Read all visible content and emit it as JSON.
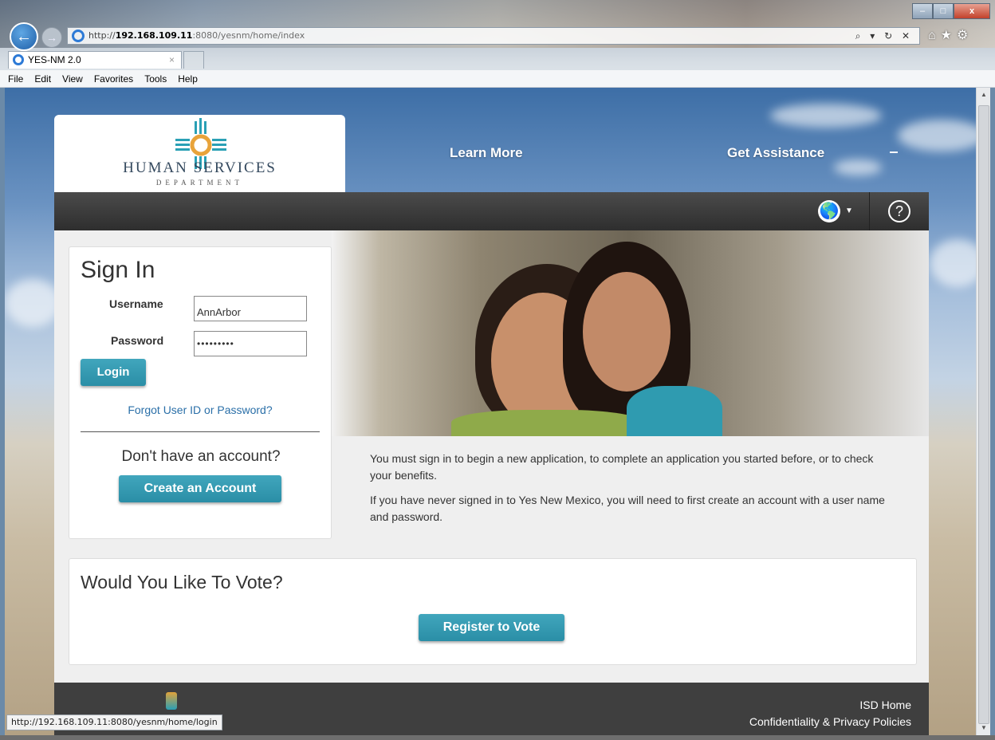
{
  "browser": {
    "address": {
      "scheme": "http://",
      "host": "192.168.109.11",
      "path": ":8080/yesnm/home/index"
    },
    "address_icons": "⌕ ▾ ↻ ✕",
    "toolbar_icons": "⌂★⚙",
    "tab_title": "YES-NM 2.0",
    "tab_close": "×",
    "window_buttons": {
      "minimize": "–",
      "maximize": "□",
      "close": "x"
    },
    "menu": [
      "File",
      "Edit",
      "View",
      "Favorites",
      "Tools",
      "Help"
    ],
    "status_url": "http://192.168.109.11:8080/yesnm/home/login",
    "back_icon": "←",
    "forward_icon": "→"
  },
  "site": {
    "logo": {
      "title": "HUMAN SERVICES",
      "subtitle": "DEPARTMENT"
    },
    "nav": {
      "learn_more": "Learn More",
      "get_assistance": "Get Assistance"
    },
    "globe_icon": "language-globe-icon",
    "help_label": "?"
  },
  "signin": {
    "title": "Sign In",
    "username_label": "Username",
    "username_value": "AnnArbor",
    "password_label": "Password",
    "password_value": "•••••••••",
    "login_button": "Login",
    "forgot_link": "Forgot User ID or Password?",
    "no_account": "Don't have an account?",
    "create_button": "Create an Account"
  },
  "info": {
    "p1": "You must sign in to begin a new application, to complete an application you started before, or to check your benefits.",
    "p2": "If you have never signed in to Yes New Mexico, you will need to first create an account with a user name and password."
  },
  "vote": {
    "title": "Would You Like To Vote?",
    "button": "Register to Vote"
  },
  "footer": {
    "links": [
      "ISD Home",
      "Confidentiality & Privacy Policies"
    ]
  }
}
